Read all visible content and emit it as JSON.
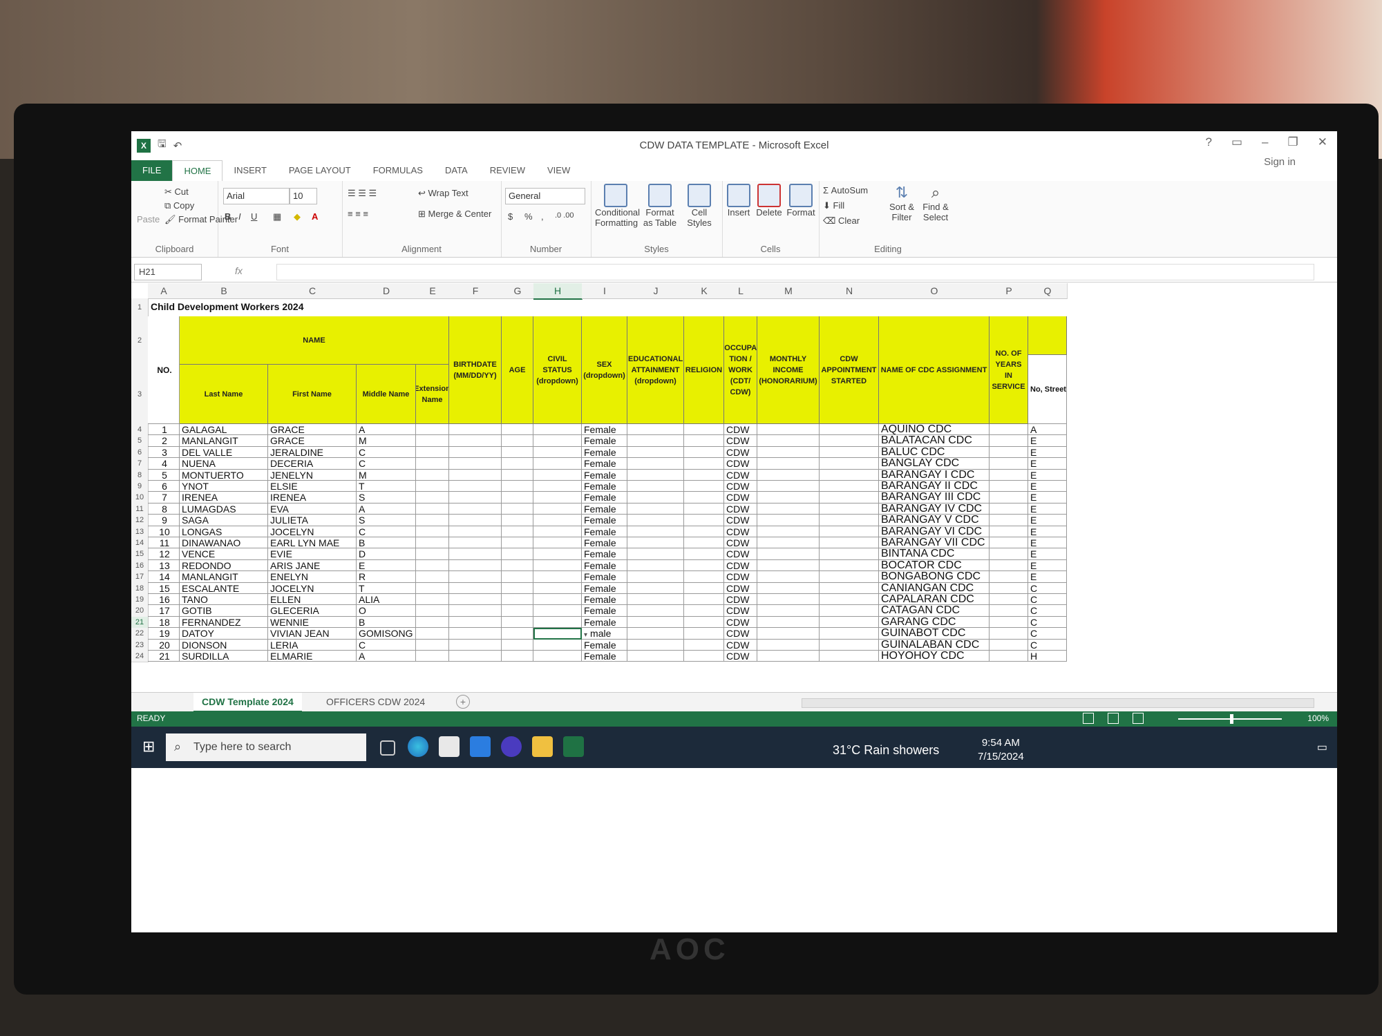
{
  "window": {
    "title": "CDW DATA TEMPLATE - Microsoft Excel",
    "sign_in": "Sign in",
    "controls": [
      "?",
      "▭",
      "–",
      "❐",
      "✕"
    ]
  },
  "ribbon_tabs": [
    "FILE",
    "HOME",
    "INSERT",
    "PAGE LAYOUT",
    "FORMULAS",
    "DATA",
    "REVIEW",
    "VIEW"
  ],
  "ribbon": {
    "clipboard": {
      "label": "Clipboard",
      "paste": "Paste",
      "cut": "Cut",
      "copy": "Copy",
      "format_painter": "Format Painter"
    },
    "font": {
      "label": "Font",
      "font_name": "Arial",
      "font_size": "10",
      "bold": "B",
      "italic": "I",
      "underline": "U"
    },
    "alignment": {
      "label": "Alignment",
      "wrap_text": "Wrap Text",
      "merge_center": "Merge & Center"
    },
    "number": {
      "label": "Number",
      "format": "General",
      "currency": "$",
      "percent": "%",
      "comma": ","
    },
    "styles": {
      "label": "Styles",
      "conditional": "Conditional Formatting",
      "format_table": "Format as Table",
      "cell_styles": "Cell Styles"
    },
    "cells": {
      "label": "Cells",
      "insert": "Insert",
      "delete": "Delete",
      "format": "Format"
    },
    "editing": {
      "label": "Editing",
      "autosum": "AutoSum",
      "fill": "Fill",
      "clear": "Clear",
      "sort_filter": "Sort & Filter",
      "find_select": "Find & Select"
    }
  },
  "formula_bar": {
    "name_box": "H21",
    "fx": "fx",
    "value": ""
  },
  "columns": [
    "A",
    "B",
    "C",
    "D",
    "E",
    "F",
    "G",
    "H",
    "I",
    "J",
    "K",
    "L",
    "M",
    "N",
    "O",
    "P",
    "Q"
  ],
  "sheet": {
    "title": "Child Development Workers 2024",
    "headers": {
      "name": "NAME",
      "no": "NO.",
      "last_name": "Last Name",
      "first_name": "First Name",
      "middle_name": "Middle Name",
      "extension_name": "Extension Name",
      "birthdate": "BIRTHDATE (MM/DD/YY)",
      "age": "AGE",
      "civil_status": "CIVIL STATUS (dropdown)",
      "sex": "SEX (dropdown)",
      "education": "EDUCATIONAL ATTAINMENT (dropdown)",
      "religion": "RELIGION",
      "occupation": "OCCUPA TION / WORK (CDT/ CDW)",
      "monthly_income": "MONTHLY INCOME (HONORARIUM)",
      "appointment": "CDW APPOINTMENT STARTED",
      "cdc_assignment": "NAME OF CDC ASSIGNMENT",
      "years_service": "NO. OF YEARS IN SERVICE",
      "street": "No, Street"
    },
    "row_numbers": [
      "1",
      "2",
      "3",
      "4",
      "5",
      "6",
      "7",
      "8",
      "9",
      "10",
      "11",
      "12",
      "13",
      "14",
      "15",
      "16",
      "17",
      "18",
      "19",
      "20",
      "21",
      "22",
      "23",
      "24"
    ],
    "rows": [
      {
        "no": "1",
        "last": "GALAGAL",
        "first": "GRACE",
        "middle": "A",
        "sex": "Female",
        "occ": "CDW",
        "cdc": "AQUINO CDC",
        "q": "A"
      },
      {
        "no": "2",
        "last": "MANLANGIT",
        "first": "GRACE",
        "middle": "M",
        "sex": "Female",
        "occ": "CDW",
        "cdc": "BALATACAN CDC",
        "q": "E"
      },
      {
        "no": "3",
        "last": "DEL VALLE",
        "first": "JERALDINE",
        "middle": "C",
        "sex": "Female",
        "occ": "CDW",
        "cdc": "BALUC CDC",
        "q": "E"
      },
      {
        "no": "4",
        "last": "NUENA",
        "first": "DECERIA",
        "middle": "C",
        "sex": "Female",
        "occ": "CDW",
        "cdc": "BANGLAY CDC",
        "q": "E"
      },
      {
        "no": "5",
        "last": "MONTUERTO",
        "first": "JENELYN",
        "middle": "M",
        "sex": "Female",
        "occ": "CDW",
        "cdc": "BARANGAY I CDC",
        "q": "E"
      },
      {
        "no": "6",
        "last": "YNOT",
        "first": "ELSIE",
        "middle": "T",
        "sex": "Female",
        "occ": "CDW",
        "cdc": "BARANGAY II CDC",
        "q": "E"
      },
      {
        "no": "7",
        "last": "IRENEA",
        "first": "IRENEA",
        "middle": "S",
        "sex": "Female",
        "occ": "CDW",
        "cdc": "BARANGAY III CDC",
        "q": "E"
      },
      {
        "no": "8",
        "last": "LUMAGDAS",
        "first": "EVA",
        "middle": "A",
        "sex": "Female",
        "occ": "CDW",
        "cdc": "BARANGAY IV CDC",
        "q": "E"
      },
      {
        "no": "9",
        "last": "SAGA",
        "first": "JULIETA",
        "middle": "S",
        "sex": "Female",
        "occ": "CDW",
        "cdc": "BARANGAY V CDC",
        "q": "E"
      },
      {
        "no": "10",
        "last": "LONGAS",
        "first": "JOCELYN",
        "middle": "C",
        "sex": "Female",
        "occ": "CDW",
        "cdc": "BARANGAY VI CDC",
        "q": "E"
      },
      {
        "no": "11",
        "last": "DINAWANAO",
        "first": "EARL LYN MAE",
        "middle": "B",
        "sex": "Female",
        "occ": "CDW",
        "cdc": "BARANGAY VII CDC",
        "q": "E"
      },
      {
        "no": "12",
        "last": "VENCE",
        "first": "EVIE",
        "middle": "D",
        "sex": "Female",
        "occ": "CDW",
        "cdc": "BINTANA CDC",
        "q": "E"
      },
      {
        "no": "13",
        "last": "REDONDO",
        "first": "ARIS JANE",
        "middle": "E",
        "sex": "Female",
        "occ": "CDW",
        "cdc": "BOCATOR CDC",
        "q": "E"
      },
      {
        "no": "14",
        "last": "MANLANGIT",
        "first": "ENELYN",
        "middle": "R",
        "sex": "Female",
        "occ": "CDW",
        "cdc": "BONGABONG CDC",
        "q": "E"
      },
      {
        "no": "15",
        "last": "ESCALANTE",
        "first": "JOCELYN",
        "middle": "T",
        "sex": "Female",
        "occ": "CDW",
        "cdc": "CANIANGAN CDC",
        "q": "C"
      },
      {
        "no": "16",
        "last": "TANO",
        "first": "ELLEN",
        "middle": "ALIA",
        "sex": "Female",
        "occ": "CDW",
        "cdc": "CAPALARAN CDC",
        "q": "C"
      },
      {
        "no": "17",
        "last": "GOTIB",
        "first": "GLECERIA",
        "middle": "O",
        "sex": "Female",
        "occ": "CDW",
        "cdc": "CATAGAN CDC",
        "q": "C"
      },
      {
        "no": "18",
        "last": "FERNANDEZ",
        "first": "WENNIE",
        "middle": "B",
        "sex": "Female",
        "occ": "CDW",
        "cdc": "GARANG CDC",
        "q": "C"
      },
      {
        "no": "19",
        "last": "DATOY",
        "first": "VIVIAN JEAN",
        "middle": "GOMISONG",
        "sex": "male",
        "occ": "CDW",
        "cdc": "GUINABOT CDC",
        "q": "C"
      },
      {
        "no": "20",
        "last": "DIONSON",
        "first": "LERIA",
        "middle": "C",
        "sex": "Female",
        "occ": "CDW",
        "cdc": "GUINALABAN CDC",
        "q": "C"
      },
      {
        "no": "21",
        "last": "SURDILLA",
        "first": "ELMARIE",
        "middle": "A",
        "sex": "Female",
        "occ": "CDW",
        "cdc": "HOYOHOY CDC",
        "q": "H"
      }
    ]
  },
  "sheet_tabs": [
    "CDW Template 2024",
    "OFFICERS CDW 2024"
  ],
  "status": {
    "ready": "READY",
    "zoom": "100%"
  },
  "taskbar": {
    "search_placeholder": "Type here to search",
    "weather": "31°C  Rain showers",
    "time": "9:54 AM",
    "date": "7/15/2024"
  },
  "monitor_brand": "AOC",
  "colors": {
    "excel_green": "#217346",
    "header_yellow": "#e8f000",
    "taskbar": "#1c2a3a"
  }
}
